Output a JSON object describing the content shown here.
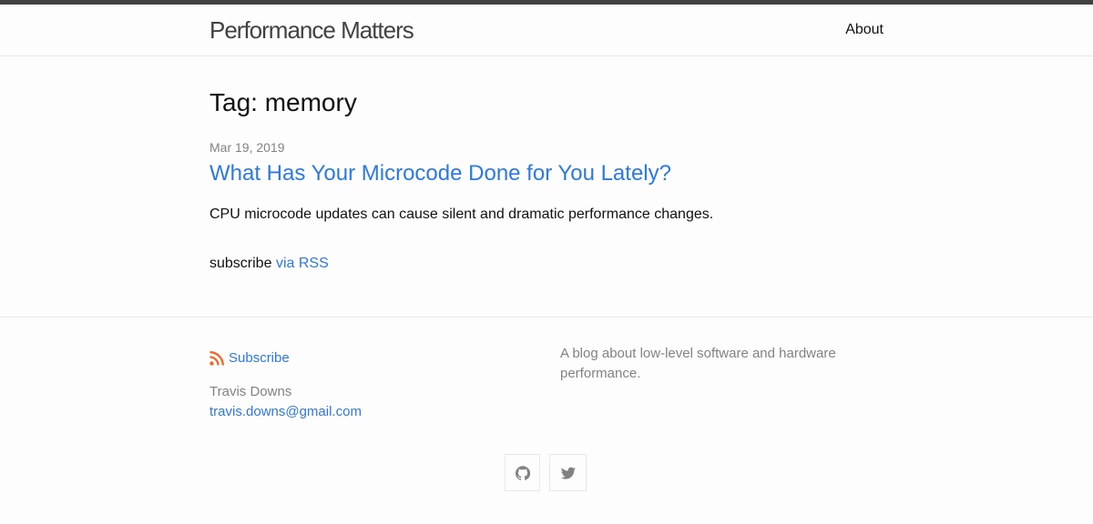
{
  "header": {
    "site_title": "Performance Matters",
    "nav": [
      {
        "label": "About"
      }
    ]
  },
  "main": {
    "heading": "Tag: memory",
    "posts": [
      {
        "date": "Mar 19, 2019",
        "title": "What Has Your Microcode Done for You Lately?",
        "excerpt": "CPU microcode updates can cause silent and dramatic performance changes."
      }
    ],
    "rss_prefix": "subscribe",
    "rss_link": "via RSS"
  },
  "footer": {
    "subscribe_label": "Subscribe",
    "author_name": "Travis Downs",
    "author_email": "travis.downs@gmail.com",
    "description": "A blog about low-level software and hardware performance.",
    "social": [
      {
        "icon": "github-icon"
      },
      {
        "icon": "twitter-icon"
      }
    ]
  },
  "colors": {
    "link": "#2a7ae2",
    "meta": "#828282",
    "rss": "#f26522",
    "top_bar": "#424242"
  }
}
